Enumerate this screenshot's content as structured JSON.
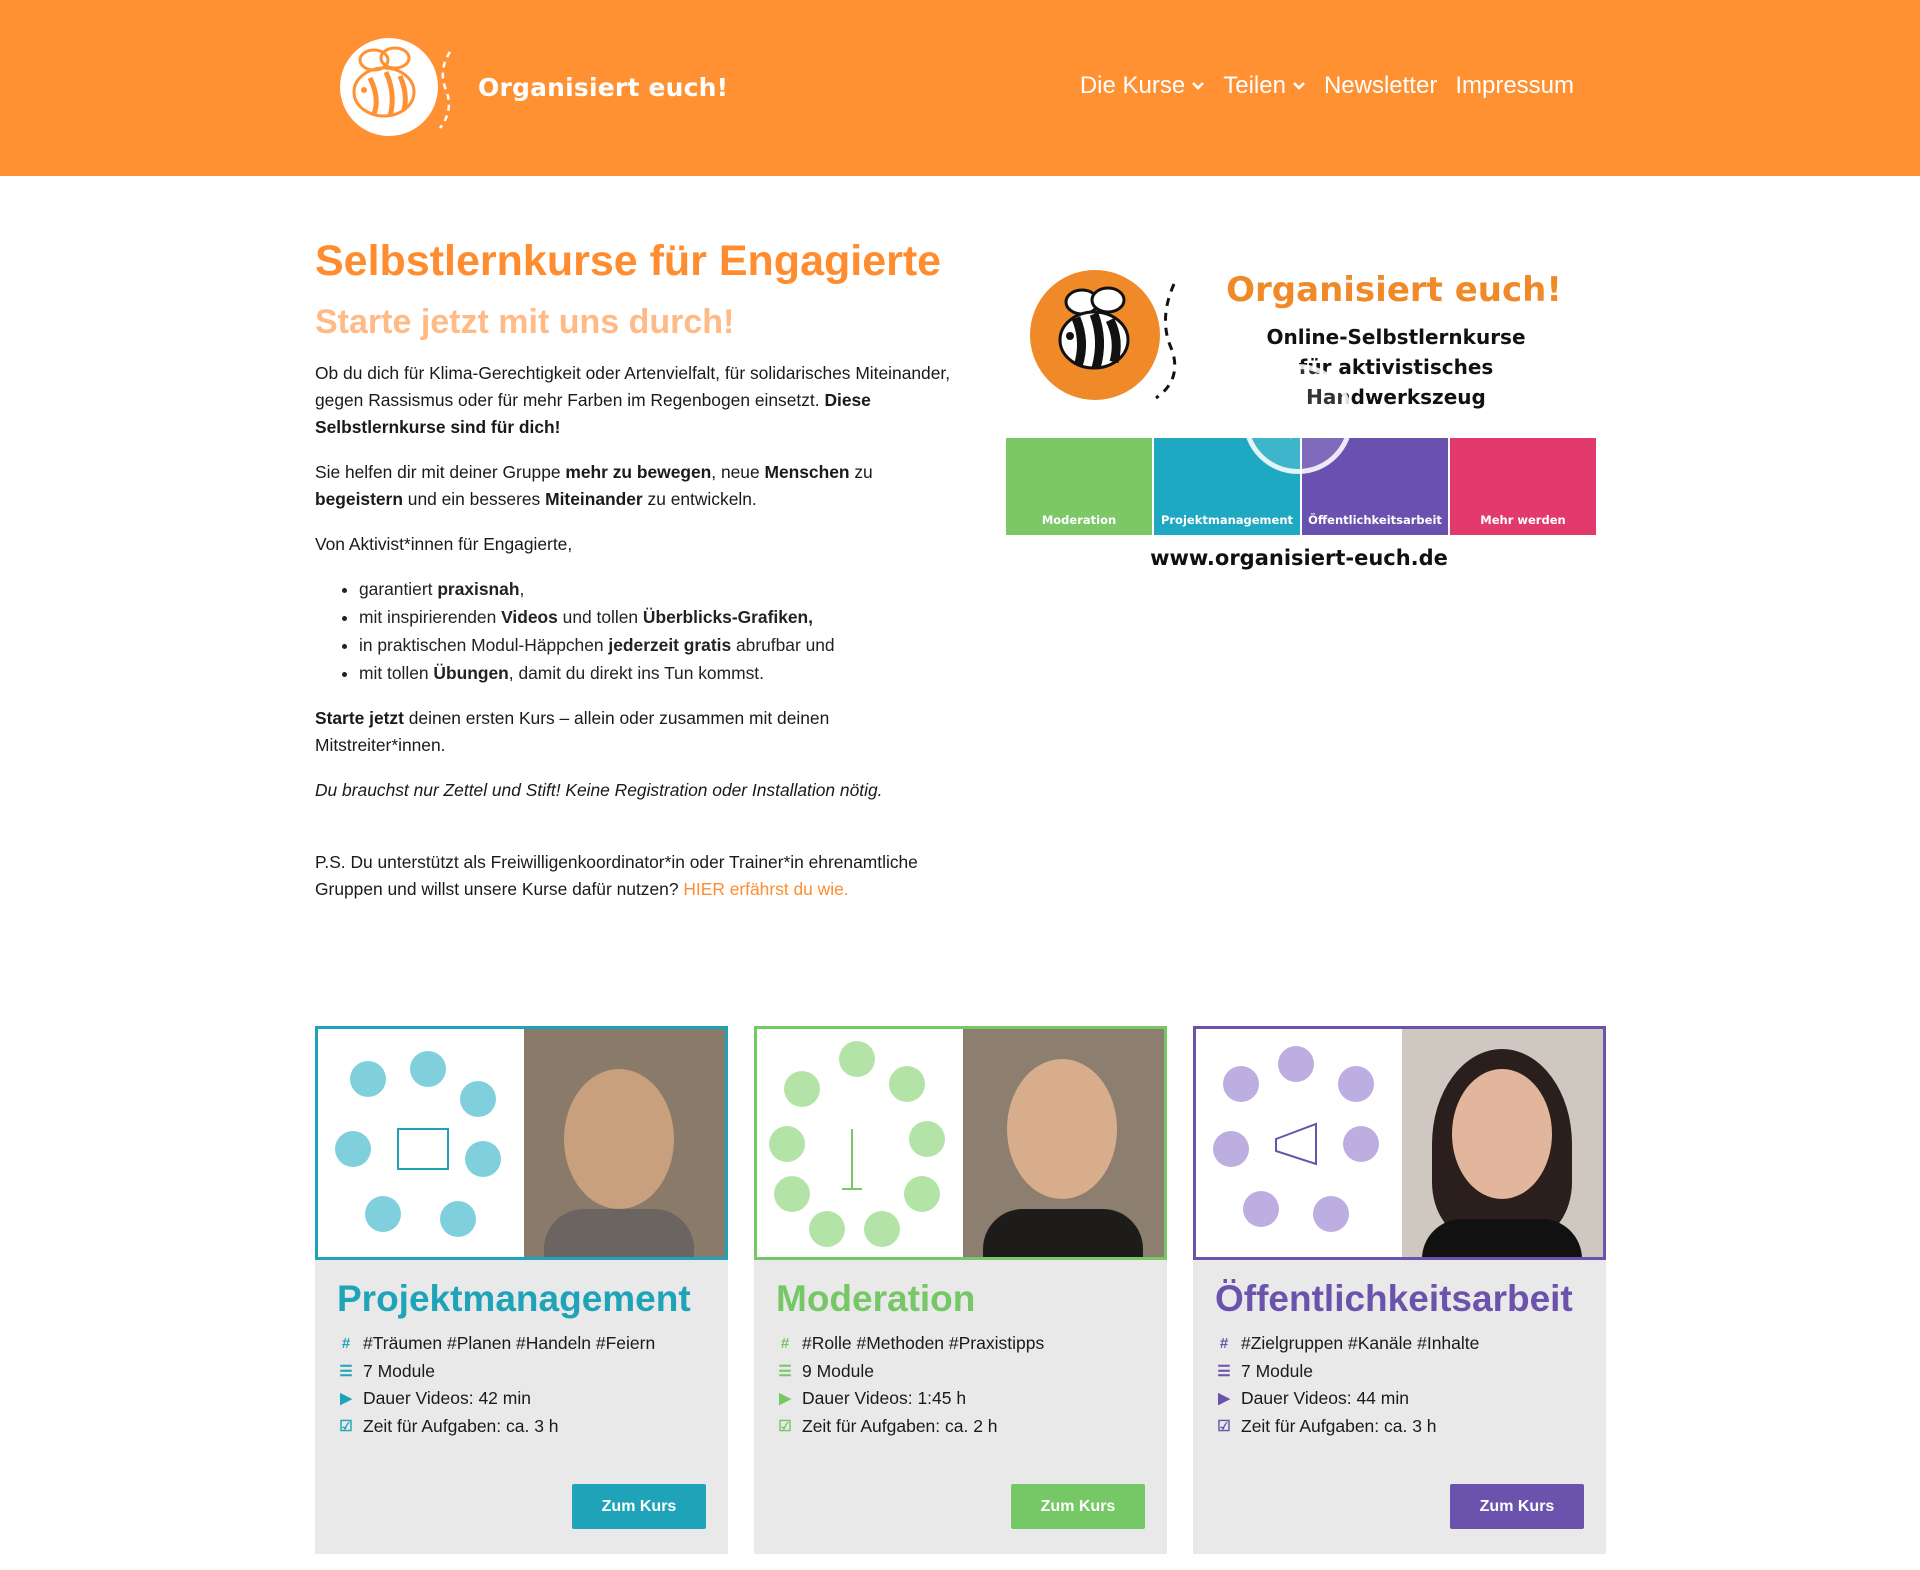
{
  "header": {
    "logo_text": "Organisiert euch!",
    "nav": [
      {
        "label": "Die Kurse",
        "dropdown": true
      },
      {
        "label": "Teilen",
        "dropdown": true
      },
      {
        "label": "Newsletter",
        "dropdown": false
      },
      {
        "label": "Impressum",
        "dropdown": false
      }
    ]
  },
  "intro": {
    "title": "Selbstlernkurse für Engagierte",
    "subtitle": "Starte jetzt mit uns durch!",
    "p1_a": "Ob du dich für Klima-Gerechtigkeit oder Artenvielfalt, für solidarisches Miteinander, gegen Rassismus oder für mehr Farben im Regenbogen einsetzt. ",
    "p1_b": "Diese Selbstlernkurse sind für dich!",
    "p2": [
      "Sie helfen dir mit deiner Gruppe ",
      "mehr zu bewegen",
      ", neue ",
      "Menschen",
      " zu ",
      "begeistern",
      " und ein besseres ",
      "Miteinander",
      " zu entwickeln."
    ],
    "p3": "Von Aktivist*innen für Engagierte,",
    "bullets": [
      [
        "garantiert ",
        "praxisnah",
        ","
      ],
      [
        "mit inspirierenden ",
        "Videos",
        " und tollen ",
        "Überblicks-Grafiken,"
      ],
      [
        "in praktischen Modul-Häppchen ",
        "jederzeit gratis",
        " abrufbar und"
      ],
      [
        "mit tollen ",
        "Übungen",
        ", damit du direkt ins Tun kommst."
      ]
    ],
    "p4_b": "Starte jetzt",
    "p4": " deinen ersten Kurs – allein oder zusammen mit deinen Mitstreiter*innen.",
    "p5": "Du brauchst nur Zettel und Stift! Keine Registration oder Installation nötig.",
    "p6": "P.S. Du unterstützt als Freiwilligenkoordinator*in oder Trainer*in ehrenamtliche Gruppen und willst unsere Kurse dafür nutzen? ",
    "p6_link": "HIER erfährst du wie."
  },
  "video": {
    "title": "Organisiert euch!",
    "sub1": "Online-Selbstlernkurse",
    "sub2": "für aktivistisches Handwerkszeug",
    "tiles": [
      {
        "label": "Moderation",
        "color": "#7cc867"
      },
      {
        "label": "Projektmanagement",
        "color": "#1ea8c2"
      },
      {
        "label": "Öffentlichkeitsarbeit",
        "color": "#6a51b0"
      },
      {
        "label": "Mehr werden",
        "color": "#e33a6d"
      }
    ],
    "url": "www.organisiert-euch.de"
  },
  "cards": [
    {
      "title": "Projektmanagement",
      "color": "#1ea3b8",
      "tags": "#Träumen #Planen #Handeln #Feiern",
      "modules": "7 Module",
      "videos": "Dauer Videos: 42 min",
      "tasks": "Zeit für Aufgaben: ca. 3 h",
      "button": "Zum Kurs"
    },
    {
      "title": "Moderation",
      "color": "#76c765",
      "tags": "#Rolle #Methoden #Praxistipps",
      "modules": "9 Module",
      "videos": "Dauer Videos: 1:45 h",
      "tasks": "Zeit für Aufgaben: ca. 2 h",
      "button": "Zum Kurs"
    },
    {
      "title": "Öffentlichkeitsarbeit",
      "color": "#6a52ad",
      "tags": "#Zielgruppen #Kanäle #Inhalte",
      "modules": "7 Module",
      "videos": "Dauer Videos: 44 min",
      "tasks": "Zeit für Aufgaben: ca. 3 h",
      "button": "Zum Kurs"
    }
  ],
  "colors": {
    "header": "#ff9133",
    "accent": "#ff8c2e",
    "subtitle": "#ffba85"
  }
}
